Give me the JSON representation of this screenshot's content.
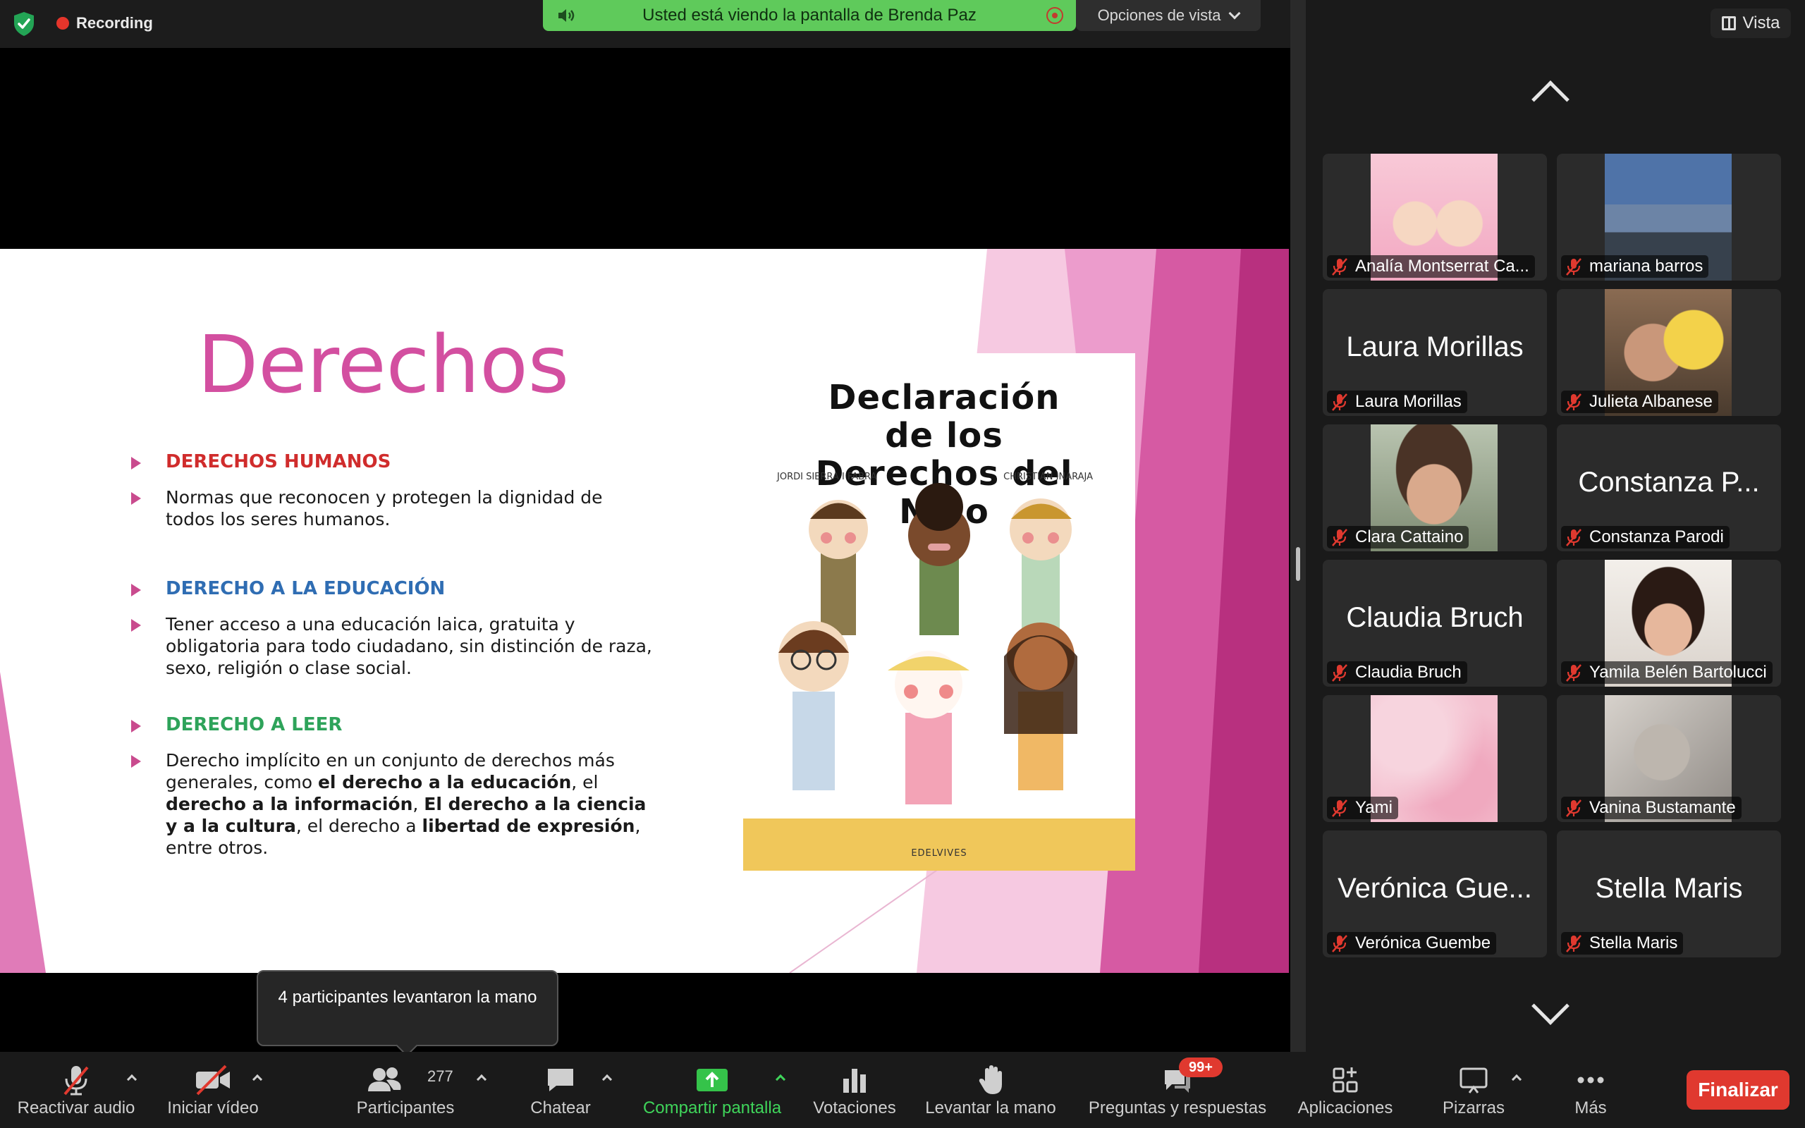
{
  "topbar": {
    "recording_label": "Recording",
    "share_banner": "Usted está viendo la pantalla de Brenda Paz",
    "view_options_label": "Opciones de vista"
  },
  "slide": {
    "title": "Derechos",
    "sections": [
      {
        "heading": "DERECHOS  HUMANOS",
        "heading_color": "#d02c2c",
        "text_parts": [
          [
            "Normas que reconocen y protegen la dignidad de todos los seres humanos.",
            false
          ]
        ]
      },
      {
        "heading": "DERECHO A LA EDUCACIÓN",
        "heading_color": "#2f6db3",
        "text_parts": [
          [
            "Tener acceso a una educación laica, gratuita y obligatoria para todo ciudadano, sin distinción de raza, sexo, religión o clase social.",
            false
          ]
        ]
      },
      {
        "heading": "DERECHO A LEER",
        "heading_color": "#2ea35a",
        "text_parts": [
          [
            "Derecho implícito en un conjunto de derechos más generales, como ",
            false
          ],
          [
            "el derecho a la educación",
            true
          ],
          [
            ", el ",
            false
          ],
          [
            "derecho a la información",
            true
          ],
          [
            ", ",
            false
          ],
          [
            "El derecho a la ciencia y a la cultura",
            true
          ],
          [
            ", el derecho a ",
            false
          ],
          [
            "libertad de expresión",
            true
          ],
          [
            ", entre otros.",
            false
          ]
        ]
      }
    ],
    "book": {
      "title": "Declaración de los Derechos del Niño",
      "author_left": "JORDI SIERRA I FABRA",
      "author_right": "CHRISTIAN INARAJA",
      "publisher": "EDELVIVES"
    }
  },
  "gallery": {
    "view_label": "Vista",
    "participants": [
      {
        "name": "Analía Montserrat Ca...",
        "display": "",
        "photo": "pink-cartoon"
      },
      {
        "name": "mariana barros",
        "display": "",
        "photo": "lake-photo"
      },
      {
        "name": "Laura Morillas",
        "display": "Laura Morillas",
        "photo": ""
      },
      {
        "name": "Julieta Albanese",
        "display": "",
        "photo": "family-photo"
      },
      {
        "name": "Clara Cattaino",
        "display": "",
        "photo": "woman-photo"
      },
      {
        "name": "Constanza Parodi",
        "display": "Constanza P...",
        "photo": ""
      },
      {
        "name": "Claudia Bruch",
        "display": "Claudia Bruch",
        "photo": ""
      },
      {
        "name": "Yamila Belén Bartolucci",
        "display": "",
        "photo": "woman2-photo"
      },
      {
        "name": "Yami",
        "display": "",
        "photo": "pink-texture"
      },
      {
        "name": "Vanina Bustamante",
        "display": "",
        "photo": "sketch-photo"
      },
      {
        "name": "Verónica Guembe",
        "display": "Verónica Gue...",
        "photo": ""
      },
      {
        "name": "Stella Maris",
        "display": "Stella Maris",
        "photo": ""
      }
    ]
  },
  "toolbar": {
    "audio_label": "Reactivar audio",
    "video_label": "Iniciar vídeo",
    "participants_label": "Participantes",
    "participants_count": "277",
    "chat_label": "Chatear",
    "share_label": "Compartir pantalla",
    "polls_label": "Votaciones",
    "raise_hand_label": "Levantar la mano",
    "qa_label": "Preguntas y respuestas",
    "qa_badge": "99+",
    "apps_label": "Aplicaciones",
    "whiteboards_label": "Pizarras",
    "more_label": "Más",
    "end_label": "Finalizar"
  },
  "tooltip": {
    "text": "4 participantes levantaron la mano"
  },
  "colors": {
    "accent_green": "#5fca5b",
    "end_red": "#e0392f",
    "slide_pink": "#d34fa0"
  }
}
